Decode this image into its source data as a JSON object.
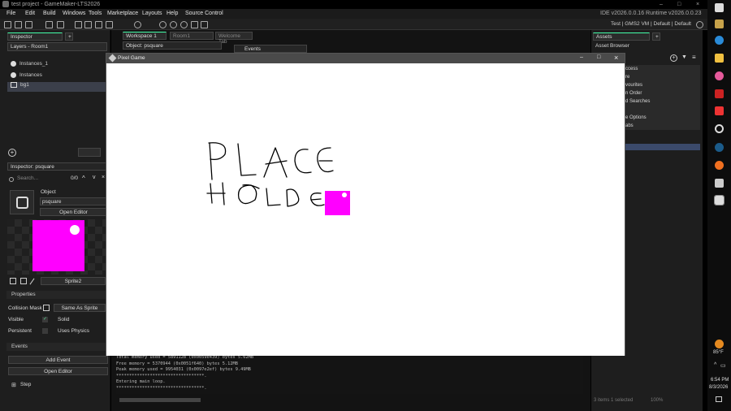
{
  "title_bar": {
    "title": "test project - GameMaker-LTS2026",
    "controls": [
      "–",
      "□",
      "×"
    ]
  },
  "menu": [
    "File",
    "Edit",
    "Build",
    "Windows",
    "Tools",
    "Marketplace",
    "Layouts",
    "Help",
    "Source Control"
  ],
  "ide_version": "IDE v2026.0.0.16  Runtime v2026.0.0.23",
  "target_bar": "Test  |  GMS2 VM  |  Default  |  Default",
  "left": {
    "inspector_tab": "Inspector",
    "layers_dropdown": "Layers - Room1",
    "layers": [
      "Instances_1",
      "Instances",
      "bg1"
    ],
    "inspector_psquare": "Inspector: psquare",
    "search_placeholder": "Search...",
    "search_count": "0/0",
    "object_label": "Object",
    "object_name": "psquare",
    "open_editor": "Open Editor",
    "sprite_name": "Sprite2",
    "properties": "Properties",
    "collision_mask": "Collision Mask",
    "same_as_sprite": "Same As Sprite",
    "visible": "Visible",
    "solid": "Solid",
    "persistent": "Persistent",
    "uses_physics": "Uses Physics",
    "events": "Events",
    "add_event": "Add Event",
    "open_editor2": "Open Editor",
    "step": "Step"
  },
  "center": {
    "workspace_tab": "Workspace 1",
    "room_tab": "Room1",
    "welcome_tab": "Welcome Tab",
    "object_window": "Object: psquare",
    "events_window": "Events"
  },
  "console_lines": [
    "Total memory used = 5891128 (0x0059e439) bytes 5.62MB",
    "Free memory = 5370944 (0x0051f640) bytes 5.12MB",
    "Peak memory used = 9954031 (0x0097e2ef) bytes 9.49MB",
    "**********************************.",
    "Entering main loop.",
    "**********************************."
  ],
  "right": {
    "assets_tab": "Assets",
    "asset_browser": "Asset Browser",
    "items": [
      "ccess",
      "re",
      "vourites",
      "n Order",
      "d Searches",
      "e Options",
      "abs"
    ],
    "status": "3 items   1 selected",
    "zoom": "100%"
  },
  "game_window": {
    "title": "Pixel Game",
    "controls": [
      "–",
      "□",
      "×"
    ],
    "square_color": "#ff00ff"
  },
  "taskbar": {
    "weather": "85°F",
    "time": "6:54 PM",
    "date": "8/3/2026"
  }
}
